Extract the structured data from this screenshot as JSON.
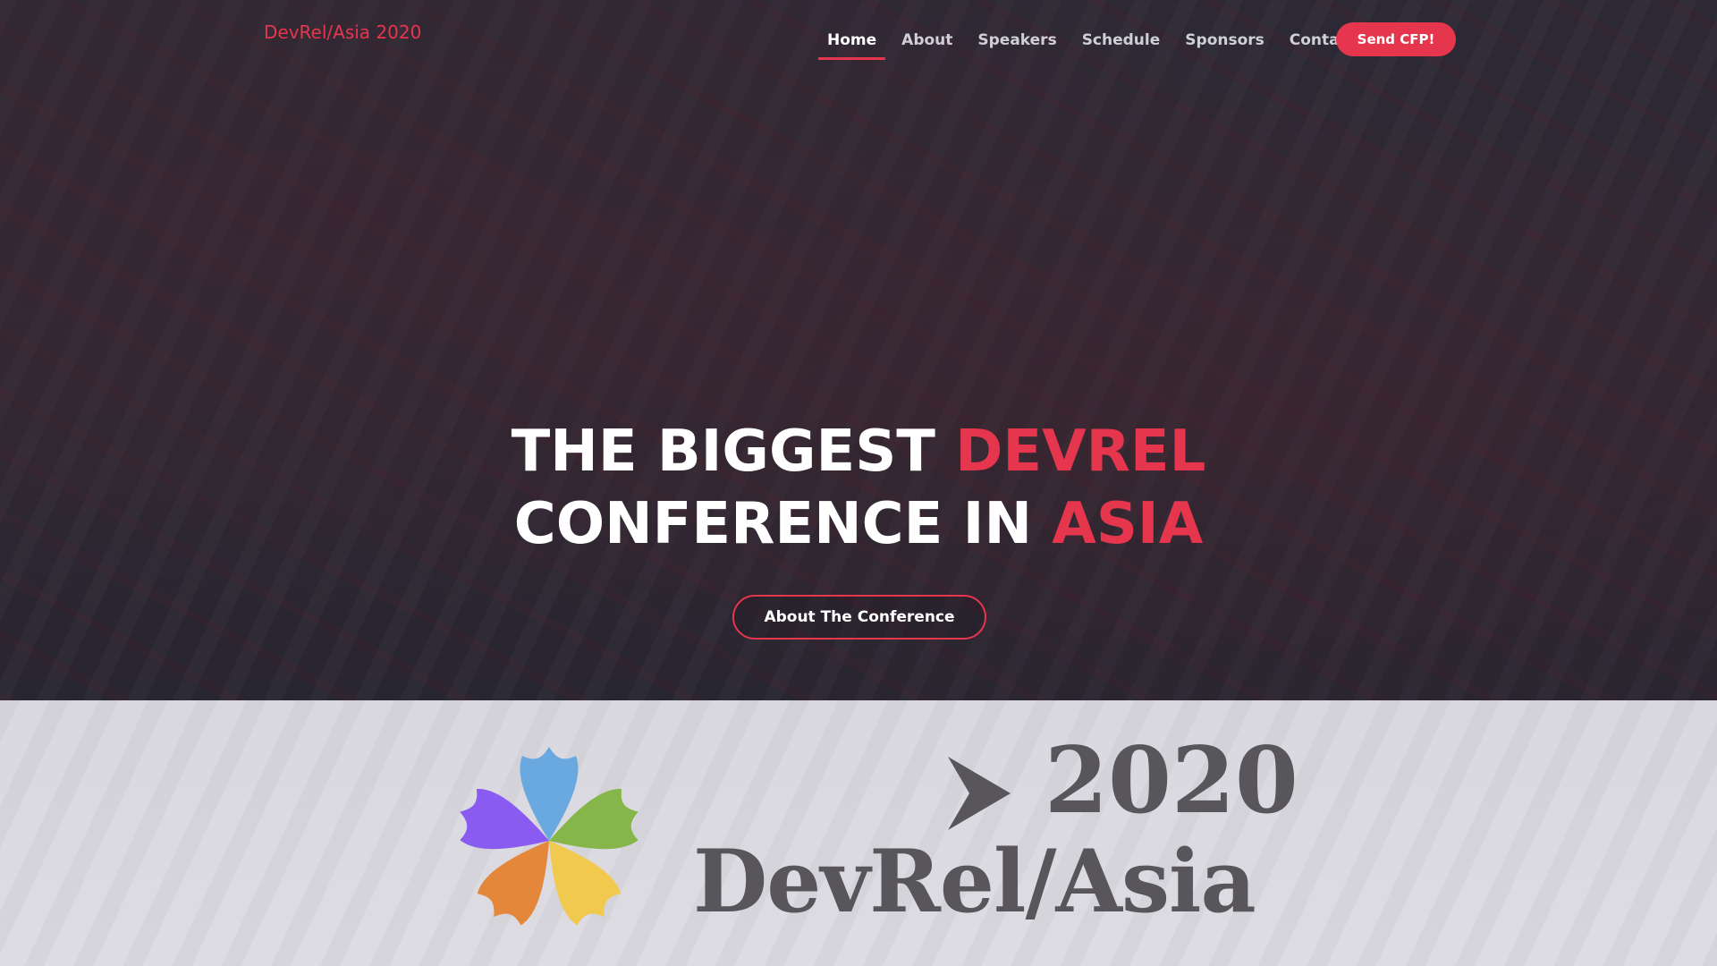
{
  "brand": "DevRel/Asia 2020",
  "nav": {
    "items": [
      {
        "label": "Home",
        "active": true
      },
      {
        "label": "About",
        "active": false
      },
      {
        "label": "Speakers",
        "active": false
      },
      {
        "label": "Schedule",
        "active": false
      },
      {
        "label": "Sponsors",
        "active": false
      },
      {
        "label": "Contact",
        "active": false
      }
    ],
    "cta_label": "Send CFP!"
  },
  "hero": {
    "line1_white": "THE BIGGEST ",
    "line1_accent": "DEVREL",
    "line2_white": "CONFERENCE IN ",
    "line2_accent": "ASIA",
    "button_label": "About The Conference"
  },
  "logo_band": {
    "year": "2020",
    "wordmark": "DevRel/Asia"
  },
  "colors": {
    "accent": "#e5364e",
    "petal_blue": "#6aa9e0",
    "petal_green": "#86b64a",
    "petal_yellow": "#f0c94e",
    "petal_orange": "#e4873a",
    "petal_purple": "#8a5bf0",
    "wordmark_gray": "#58565a"
  },
  "icons": {
    "logo_flower": "flower-logo-icon",
    "logo_arrow": "chevron-right-icon"
  }
}
